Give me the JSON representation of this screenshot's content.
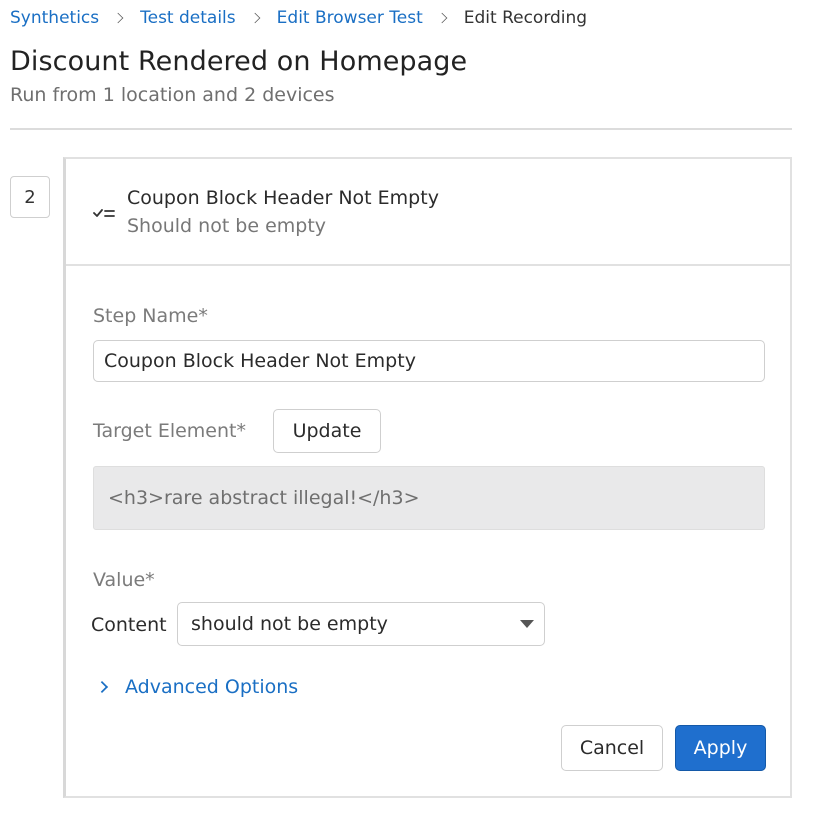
{
  "breadcrumb": {
    "items": [
      "Synthetics",
      "Test details",
      "Edit Browser Test"
    ],
    "current": "Edit Recording"
  },
  "page": {
    "title": "Discount Rendered on Homepage",
    "subtitle": "Run from 1 location and 2 devices"
  },
  "step": {
    "number": "2",
    "icon": "assertion-checklist-icon",
    "title": "Coupon Block Header Not Empty",
    "description": "Should not be empty"
  },
  "form": {
    "step_name_label": "Step Name*",
    "step_name_value": "Coupon Block Header Not Empty",
    "target_label": "Target Element*",
    "update_label": "Update",
    "target_value": "<h3>rare abstract illegal!</h3>",
    "value_label": "Value*",
    "content_label": "Content",
    "content_select": "should not be empty",
    "advanced_label": "Advanced Options",
    "cancel_label": "Cancel",
    "apply_label": "Apply"
  },
  "colors": {
    "link": "#1a6fc4",
    "primary": "#1f6fce",
    "target_bg": "#e9e9ea"
  }
}
